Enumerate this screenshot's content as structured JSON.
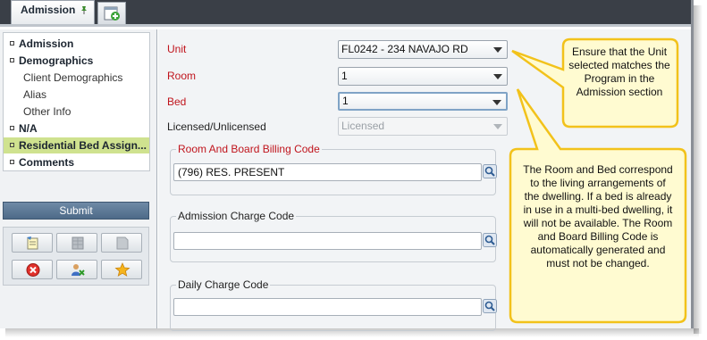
{
  "tabs": {
    "active_label": "Admission"
  },
  "sidebar": {
    "items": [
      {
        "label": "Admission",
        "level": "main"
      },
      {
        "label": "Demographics",
        "level": "main"
      },
      {
        "label": "Client Demographics",
        "level": "sub"
      },
      {
        "label": "Alias",
        "level": "sub"
      },
      {
        "label": "Other Info",
        "level": "sub"
      },
      {
        "label": "N/A",
        "level": "main"
      },
      {
        "label": "Residential Bed Assign...",
        "level": "main",
        "selected": true
      },
      {
        "label": "Comments",
        "level": "main"
      }
    ],
    "submit_label": "Submit",
    "toolbar_icons": [
      "note-icon",
      "grid-icon",
      "blank-icon",
      "delete-icon",
      "users-icon",
      "star-icon"
    ]
  },
  "form": {
    "unit": {
      "label": "Unit",
      "value": "FL0242 - 234 NAVAJO RD"
    },
    "room": {
      "label": "Room",
      "value": "1"
    },
    "bed": {
      "label": "Bed",
      "value": "1"
    },
    "licensed": {
      "label": "Licensed/Unlicensed",
      "value": "Licensed"
    },
    "room_board": {
      "label": "Room And Board Billing Code",
      "value": "(796) RES. PRESENT"
    },
    "admission_charge": {
      "label": "Admission Charge Code",
      "value": ""
    },
    "daily_charge": {
      "label": "Daily Charge Code",
      "value": ""
    }
  },
  "callouts": {
    "unit_note": "Ensure that the Unit selected matches the Program in the Admission section",
    "bed_note": "The Room and Bed correspond to the living arrangements of the dwelling.  If a bed is already in use in a multi-bed dwelling, it will not be available.  The Room and Board Billing Code is automatically generated and must not be changed."
  },
  "colors": {
    "required_label": "#c0141c",
    "selected_nav": "#cfe28f",
    "callout_fill": "#fffbd1",
    "callout_border": "#f2c21b"
  }
}
